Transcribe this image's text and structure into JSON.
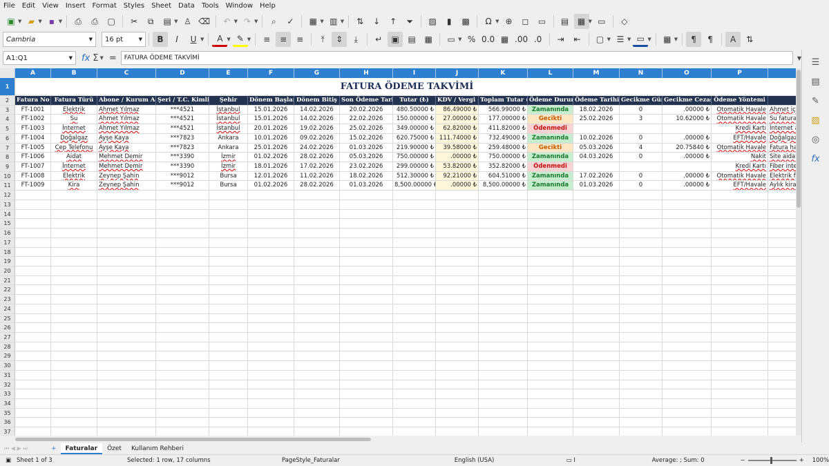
{
  "menu": [
    "File",
    "Edit",
    "View",
    "Insert",
    "Format",
    "Styles",
    "Sheet",
    "Data",
    "Tools",
    "Window",
    "Help"
  ],
  "font": {
    "name": "Cambria",
    "size": "16 pt"
  },
  "namebox": "A1:Q1",
  "formula": "FATURA ÖDEME TAKVİMİ",
  "columns": [
    "A",
    "B",
    "C",
    "D",
    "E",
    "F",
    "G",
    "H",
    "I",
    "J",
    "K",
    "L",
    "M",
    "N",
    "O",
    "P",
    ""
  ],
  "title": "FATURA ÖDEME TAKVİMİ",
  "headers": [
    "Fatura No",
    "Fatura Türü",
    "Abone / Kurum Adı",
    "Şeri / T.C. Kimlik",
    "Şehir",
    "Dönem Başlangıç",
    "Dönem Bitiş",
    "Son Ödeme Tarihi",
    "Tutar (₺)",
    "KDV / Vergi (₺)",
    "Toplam Tutar (₺)",
    "Ödeme Durumu",
    "Ödeme Tarihi",
    "Gecikme Günü",
    "Gecikme Cezası ₺",
    "Ödeme Yöntemi",
    ""
  ],
  "rows": [
    [
      "FT-1001",
      "Elektrik",
      "Ahmet Yılmaz",
      "***4521",
      "İstanbul",
      "15.01.2026",
      "14.02.2026",
      "20.02.2026",
      "480.50000 ₺",
      "86.49000 ₺",
      "566.99000 ₺",
      "Zamanında",
      "18.02.2026",
      "0",
      ".00000 ₺",
      "Otomatik Havale",
      "Ahmet içi"
    ],
    [
      "FT-1002",
      "Su",
      "Ahmet Yılmaz",
      "***4521",
      "İstanbul",
      "15.01.2026",
      "14.02.2026",
      "22.02.2026",
      "150.00000 ₺",
      "27.00000 ₺",
      "177.00000 ₺",
      "Gecikti",
      "25.02.2026",
      "3",
      "10.62000 ₺",
      "Otomatik Havale",
      "Su faturas"
    ],
    [
      "FT-1003",
      "İnternet",
      "Ahmet Yılmaz",
      "***4521",
      "İstanbul",
      "20.01.2026",
      "19.02.2026",
      "25.02.2026",
      "349.00000 ₺",
      "62.82000 ₺",
      "411.82000 ₺",
      "Ödenmedi",
      "",
      "",
      "",
      "Kredi Kartı",
      "İnternet a"
    ],
    [
      "FT-1004",
      "Doğalgaz",
      "Ayşe Kaya",
      "***7823",
      "Ankara",
      "10.01.2026",
      "09.02.2026",
      "15.02.2026",
      "620.75000 ₺",
      "111.74000 ₺",
      "732.49000 ₺",
      "Zamanında",
      "10.02.2026",
      "0",
      ".00000 ₺",
      "EFT/Havale",
      "Doğalgaz"
    ],
    [
      "FT-1005",
      "Cep Telefonu",
      "Ayşe Kaya",
      "***7823",
      "Ankara",
      "25.01.2026",
      "24.02.2026",
      "01.03.2026",
      "219.90000 ₺",
      "39.58000 ₺",
      "259.48000 ₺",
      "Gecikti",
      "05.03.2026",
      "4",
      "20.75840 ₺",
      "Otomatik Havale",
      "Fatura ha"
    ],
    [
      "FT-1006",
      "Aidat",
      "Mehmet Demir",
      "***3390",
      "İzmir",
      "01.02.2026",
      "28.02.2026",
      "05.03.2026",
      "750.00000 ₺",
      ".00000 ₺",
      "750.00000 ₺",
      "Zamanında",
      "04.03.2026",
      "0",
      ".00000 ₺",
      "Nakit",
      "Site aidatı"
    ],
    [
      "FT-1007",
      "İnternet",
      "Mehmet Demir",
      "***3390",
      "İzmir",
      "18.01.2026",
      "17.02.2026",
      "23.02.2026",
      "299.00000 ₺",
      "53.82000 ₺",
      "352.82000 ₺",
      "Ödenmedi",
      "",
      "",
      "",
      "Kredi Kartı",
      "Fiber inte"
    ],
    [
      "FT-1008",
      "Elektrik",
      "Zeynep Şahin",
      "***9012",
      "Bursa",
      "12.01.2026",
      "11.02.2026",
      "18.02.2026",
      "512.30000 ₺",
      "92.21000 ₺",
      "604.51000 ₺",
      "Zamanında",
      "17.02.2026",
      "0",
      ".00000 ₺",
      "Otomatik Havale",
      "Elektrik fa"
    ],
    [
      "FT-1009",
      "Kira",
      "Zeynep Şahin",
      "***9012",
      "Bursa",
      "01.02.2026",
      "28.02.2026",
      "01.03.2026",
      "8,500.00000 ₺",
      ".00000 ₺",
      "8,500.00000 ₺",
      "Zamanında",
      "01.03.2026",
      "0",
      ".00000 ₺",
      "EFT/Havale",
      "Aylık kira"
    ]
  ],
  "sheets": [
    "Faturalar",
    "Özet",
    "Kullanım Rehberi"
  ],
  "status": {
    "sheet": "Sheet 1 of 3",
    "selected": "Selected: 1 row, 17 columns",
    "pagestyle": "PageStyle_Faturalar",
    "lang": "English (USA)",
    "sum": "Average: ; Sum: 0",
    "zoom": "100%"
  },
  "colors": {
    "header_blue": "#2e7fd0",
    "header_dark": "#22324f",
    "green": "#1c7a2e",
    "orange": "#c45c00",
    "red": "#c01010"
  }
}
